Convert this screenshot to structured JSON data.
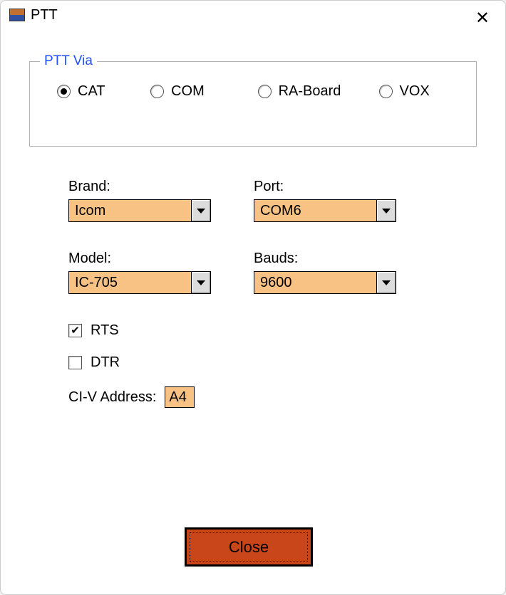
{
  "window": {
    "title": "PTT"
  },
  "groupbox": {
    "legend": "PTT Via",
    "options": {
      "cat": "CAT",
      "com": "COM",
      "raboard": "RA-Board",
      "vox": "VOX"
    },
    "selected": "cat"
  },
  "fields": {
    "brand": {
      "label": "Brand:",
      "value": "Icom"
    },
    "port": {
      "label": "Port:",
      "value": "COM6"
    },
    "model": {
      "label": "Model:",
      "value": "IC-705"
    },
    "bauds": {
      "label": "Bauds:",
      "value": "9600"
    }
  },
  "checks": {
    "rts": {
      "label": "RTS",
      "checked": true
    },
    "dtr": {
      "label": "DTR",
      "checked": false
    }
  },
  "civ": {
    "label": "CI-V Address:",
    "value": "A4"
  },
  "buttons": {
    "close": "Close"
  }
}
